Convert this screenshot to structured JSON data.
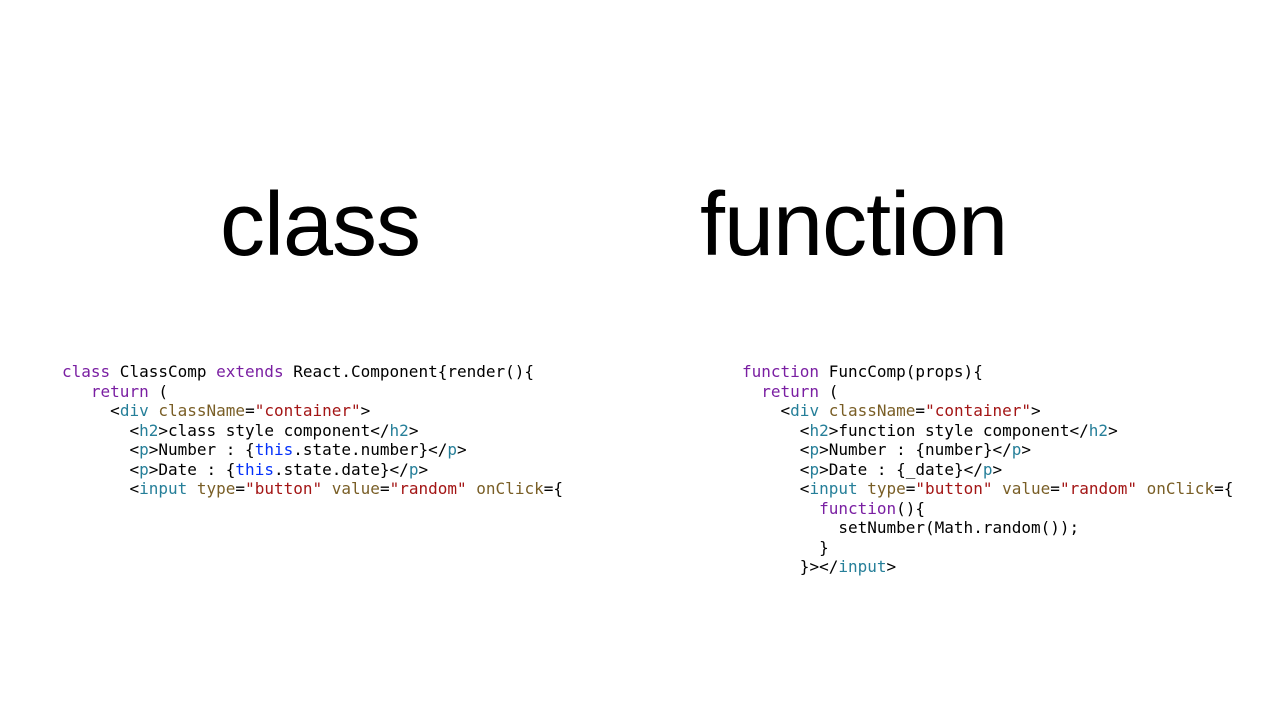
{
  "headings": {
    "left": "class",
    "right": "function"
  },
  "code": {
    "class": {
      "l1": {
        "kw_class": "class",
        "name": " ClassComp ",
        "kw_extends": "extends",
        "rest": " React.Component{render(){"
      },
      "l2": {
        "kw_return": "return",
        "rest": " ("
      },
      "l3": {
        "lt": "<",
        "tag": "div",
        "sp": " ",
        "attr": "className",
        "eq": "=",
        "str": "\"container\"",
        "gt": ">"
      },
      "l4": {
        "lt1": "<",
        "tag1": "h2",
        "gt1": ">",
        "text": "class style component",
        "lt2": "</",
        "tag2": "h2",
        "gt2": ">"
      },
      "l5": {
        "lt1": "<",
        "tag1": "p",
        "gt1": ">",
        "t1": "Number : {",
        "kw_this": "this",
        "t2": ".state.number}",
        "lt2": "</",
        "tag2": "p",
        "gt2": ">"
      },
      "l6": {
        "lt1": "<",
        "tag1": "p",
        "gt1": ">",
        "t1": "Date : {",
        "kw_this": "this",
        "t2": ".state.date}",
        "lt2": "</",
        "tag2": "p",
        "gt2": ">"
      },
      "l7": {
        "lt": "<",
        "tag": "input",
        "sp1": " ",
        "a1": "type",
        "eq1": "=",
        "s1": "\"button\"",
        "sp2": " ",
        "a2": "value",
        "eq2": "=",
        "s2": "\"random\"",
        "sp3": " ",
        "a3": "onClick",
        "eq3": "=",
        "br": "{"
      }
    },
    "func": {
      "l1": {
        "kw_function": "function",
        "rest": " FuncComp(props){"
      },
      "l2": {
        "kw_return": "return",
        "rest": " ("
      },
      "l3": {
        "lt": "<",
        "tag": "div",
        "sp": " ",
        "attr": "className",
        "eq": "=",
        "str": "\"container\"",
        "gt": ">"
      },
      "l4": {
        "lt1": "<",
        "tag1": "h2",
        "gt1": ">",
        "text": "function style component",
        "lt2": "</",
        "tag2": "h2",
        "gt2": ">"
      },
      "l5": {
        "lt1": "<",
        "tag1": "p",
        "gt1": ">",
        "text": "Number : {number}",
        "lt2": "</",
        "tag2": "p",
        "gt2": ">"
      },
      "l6": {
        "lt1": "<",
        "tag1": "p",
        "gt1": ">",
        "text": "Date : {_date}",
        "lt2": "</",
        "tag2": "p",
        "gt2": ">"
      },
      "l7": {
        "lt": "<",
        "tag": "input",
        "sp1": " ",
        "a1": "type",
        "eq1": "=",
        "s1": "\"button\"",
        "sp2": " ",
        "a2": "value",
        "eq2": "=",
        "s2": "\"random\"",
        "sp3": " ",
        "a3": "onClick",
        "eq3": "=",
        "br": "{"
      },
      "l8": {
        "kw_function": "function",
        "rest": "(){"
      },
      "l9": {
        "text": "setNumber(Math.random());"
      },
      "l10": {
        "text": "}"
      },
      "l11": {
        "t1": "}",
        "gt1": ">",
        "lt2": "</",
        "tag2": "input",
        "gt2": ">"
      }
    }
  }
}
